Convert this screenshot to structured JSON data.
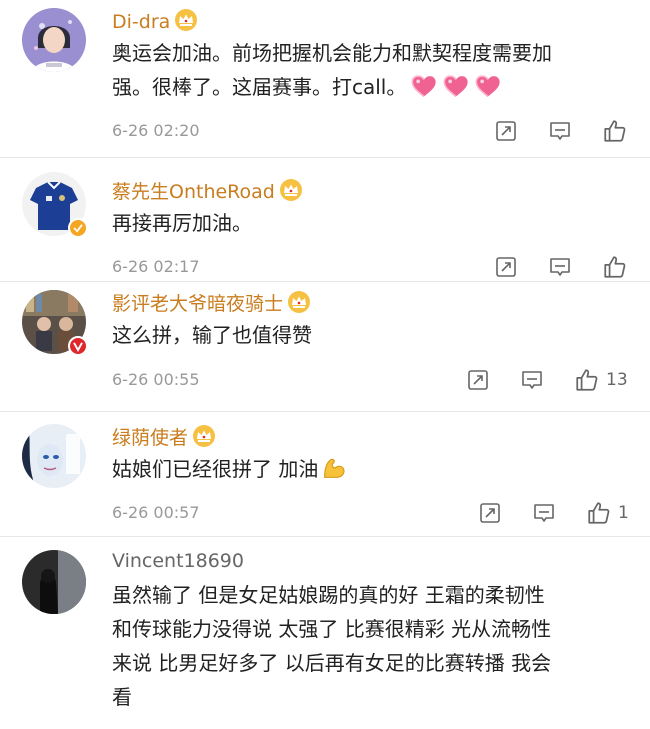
{
  "comments": [
    {
      "username": "Di-dra",
      "text_line1": "奥运会加油。前场把握机会能力和默契程度需要加",
      "text_line2": "强。很棒了。这届赛事。打call。",
      "emoji": "pink-heart-emoji",
      "time": "6-26 02:20",
      "likes": ""
    },
    {
      "username": "蔡先生OntheRoad",
      "text": "再接再厉加油。",
      "time": "6-26 02:17",
      "likes": ""
    },
    {
      "username": "影评老大爷暗夜骑士",
      "text": "这么拼，输了也值得赞",
      "time": "6-26 00:55",
      "likes": "13"
    },
    {
      "username": "绿荫使者",
      "text": "姑娘们已经很拼了 加油",
      "emoji": "flexed-biceps-emoji",
      "time": "6-26 00:57",
      "likes": "1"
    },
    {
      "username": "Vincent18690",
      "lines": [
        "虽然输了 但是女足姑娘踢的真的好 王霜的柔韧性",
        "和传球能力没得说 太强了 比赛很精彩 光从流畅性",
        "来说 比男足好多了 以后再有女足的比赛转播 我会",
        "看"
      ]
    }
  ],
  "icons": {
    "share": "share-icon",
    "comment": "comment-icon",
    "like": "like-icon",
    "crown": "vip-crown-icon",
    "verified": "verified-badge-icon"
  },
  "colors": {
    "username_vip": "#c97d1f",
    "meta_gray": "#999999",
    "verified_orange": "#f5a623",
    "verified_red": "#e0262b"
  }
}
